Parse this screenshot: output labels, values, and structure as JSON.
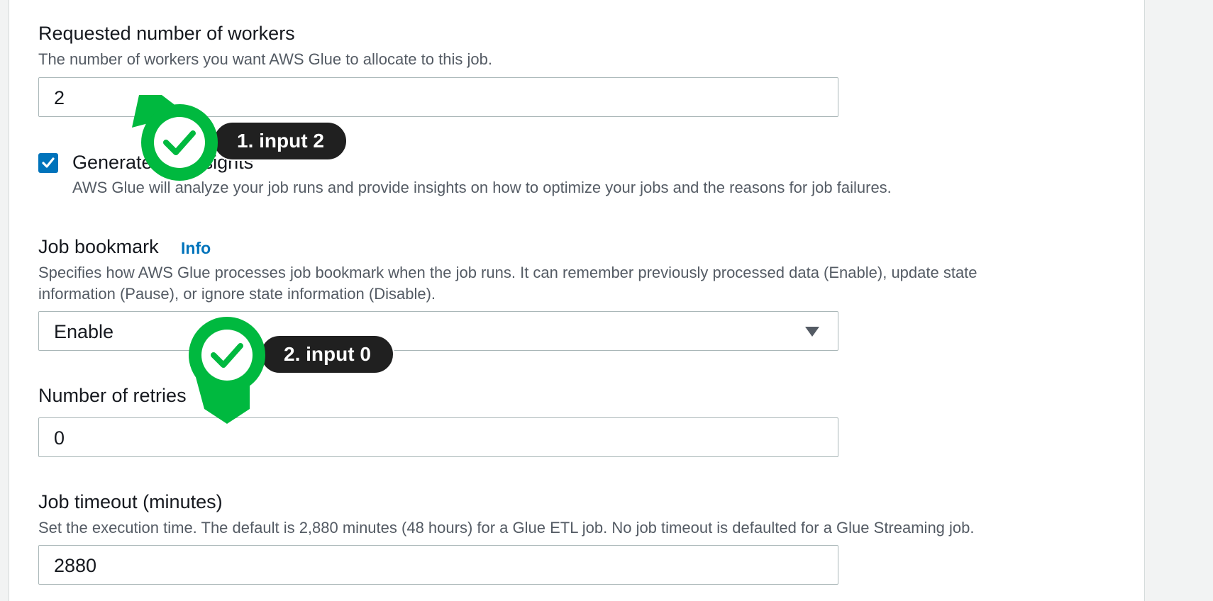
{
  "form": {
    "workers": {
      "label": "Requested number of workers",
      "description": "The number of workers you want AWS Glue to allocate to this job.",
      "value": "2"
    },
    "insights": {
      "label": "Generate job insights",
      "description": "AWS Glue will analyze your job runs and provide insights on how to optimize your jobs and the reasons for job failures.",
      "checked": true
    },
    "bookmark": {
      "label": "Job bookmark",
      "info_link": "Info",
      "description_line1": "Specifies how AWS Glue processes job bookmark when the job runs. It can remember previously processed data (Enable), update state",
      "description_line2": "information (Pause), or ignore state information (Disable).",
      "selected": "Enable"
    },
    "retries": {
      "label": "Number of retries",
      "value": "0"
    },
    "timeout": {
      "label": "Job timeout (minutes)",
      "description": "Set the execution time. The default is 2,880 minutes (48 hours) for a Glue ETL job. No job timeout is defaulted for a Glue Streaming job.",
      "value": "2880"
    }
  },
  "annotations": [
    {
      "label": "1. input 2",
      "icon": "check-icon",
      "color": "#00b93f"
    },
    {
      "label": "2. input 0",
      "icon": "check-icon",
      "color": "#00b93f"
    }
  ],
  "colors": {
    "accent": "#0073bb",
    "marker_green": "#00b93f",
    "pill_bg": "#202020"
  }
}
